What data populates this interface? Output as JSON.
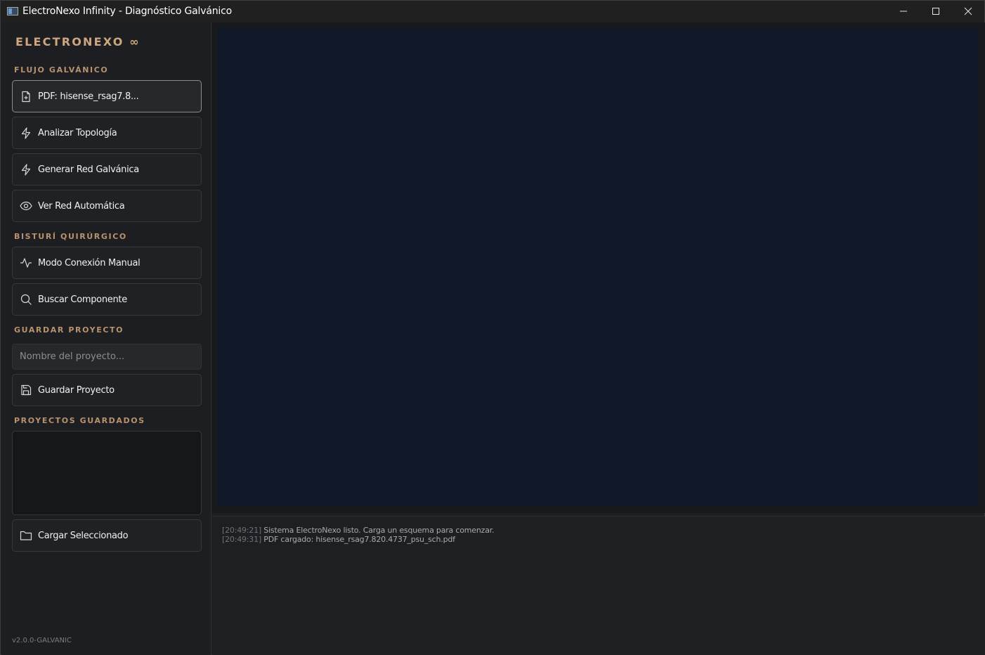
{
  "window": {
    "title": "ElectroNexo Infinity - Diagnóstico Galvánico"
  },
  "sidebar": {
    "brand": "ELECTRONEXO ∞",
    "sections": {
      "flujo": "FLUJO GALVÁNICO",
      "bisturi": "BISTURÍ QUIRÚRGICO",
      "guardar": "GUARDAR PROYECTO",
      "proyectos": "PROYECTOS GUARDADOS"
    },
    "buttons": {
      "pdf": "PDF: hisense_rsag7.8...",
      "analizar": "Analizar Topología",
      "generar": "Generar Red Galvánica",
      "ver": "Ver Red Automática",
      "modo": "Modo Conexión Manual",
      "buscar": "Buscar Componente",
      "guardar": "Guardar Proyecto",
      "cargar": "Cargar Seleccionado"
    },
    "project_name": {
      "placeholder": "Nombre del proyecto...",
      "value": ""
    },
    "saved_projects": [],
    "version": "v2.0.0-GALVANIC"
  },
  "console": {
    "lines": [
      {
        "time": "[20:49:21]",
        "text": "Sistema ElectroNexo listo. Carga un esquema para comenzar."
      },
      {
        "time": "[20:49:31]",
        "text": "PDF cargado: hisense_rsag7.820.4737_psu_sch.pdf"
      }
    ]
  },
  "colors": {
    "accent": "#cfa77e",
    "section_label": "#b8926d",
    "canvas_bg": "#101827",
    "sidebar_bg": "#1c1e21"
  },
  "icons": {
    "pdf": "file-plus-icon",
    "analizar": "bolt-icon",
    "generar": "bolt-icon",
    "ver": "eye-icon",
    "modo": "pulse-icon",
    "buscar": "search-icon",
    "guardar": "save-icon",
    "cargar": "folder-icon"
  }
}
